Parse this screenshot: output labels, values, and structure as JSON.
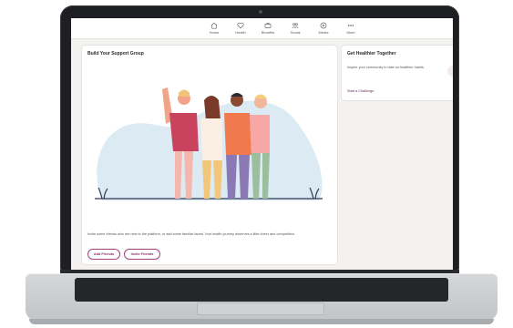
{
  "nav": {
    "items": [
      {
        "label": "Home",
        "icon": "home-icon"
      },
      {
        "label": "Health",
        "icon": "heart-icon"
      },
      {
        "label": "Benefits",
        "icon": "benefits-icon"
      },
      {
        "label": "Social",
        "icon": "social-icon"
      },
      {
        "label": "Media",
        "icon": "media-icon"
      },
      {
        "label": "More",
        "icon": "more-icon"
      }
    ]
  },
  "support_card": {
    "title": "Build Your Support Group",
    "description": "Invite some friends who are new to the platform, or add some familiar faces! Your health journey deserves a little cheer and competition.",
    "add_friends_label": "Add Friends",
    "invite_friends_label": "Invite Friends"
  },
  "challenge_card": {
    "title": "Get Healthier Together",
    "description": "Inspire your community to take on healthier habits.",
    "link_label": "Start a Challenge"
  },
  "colors": {
    "accent": "#8a2f66",
    "illustration_bg": "#dbeaf3",
    "card_bg": "#ffffff",
    "page_bg": "#f3f2f1"
  }
}
